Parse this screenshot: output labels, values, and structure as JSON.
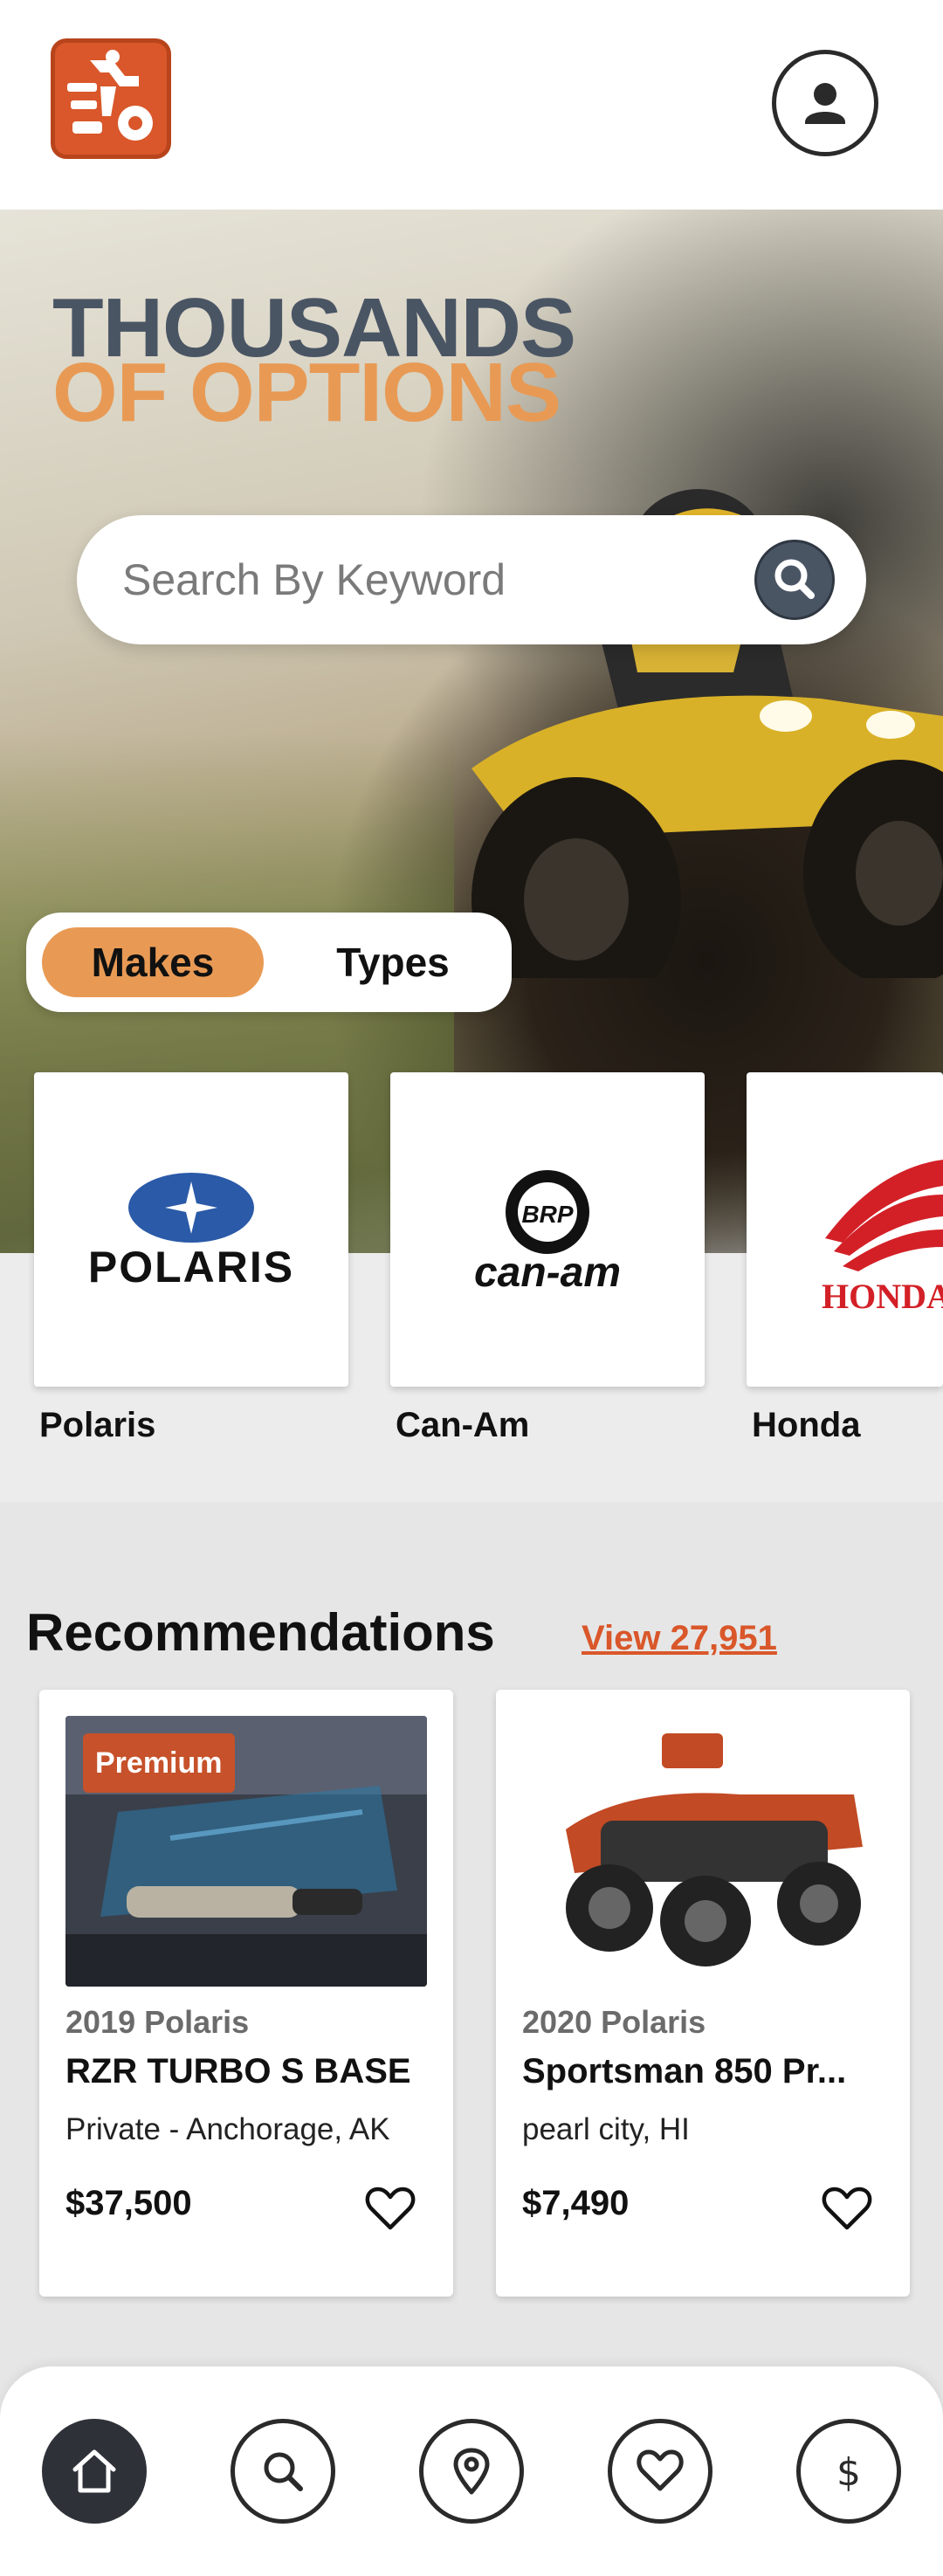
{
  "header": {
    "logo_icon": "atv-rider-logo-icon",
    "account_icon": "user-icon",
    "brand_color": "#d9572a"
  },
  "hero": {
    "title_line1": "THOUSANDS",
    "title_line2": "OF OPTIONS",
    "title_line1_color": "#4a5564",
    "title_line2_color": "#e89a55",
    "search": {
      "placeholder": "Search By Keyword",
      "button_icon": "search-icon"
    },
    "segments": [
      {
        "label": "Makes",
        "selected": true
      },
      {
        "label": "Types",
        "selected": false
      }
    ]
  },
  "brands": [
    {
      "name": "Polaris",
      "logo_text": "POLARIS"
    },
    {
      "name": "Can-Am",
      "logo_text": "can-am",
      "logo_badge": "BRP"
    },
    {
      "name": "Honda",
      "logo_text": "HONDA"
    }
  ],
  "recommendations": {
    "title": "Recommendations",
    "view_all": "View 27,951",
    "listings": [
      {
        "badge": "Premium",
        "year_make": "2019 Polaris",
        "model": "RZR TURBO S BASE",
        "location": "Private - Anchorage, AK",
        "price": "$37,500"
      },
      {
        "badge": "",
        "year_make": "2020 Polaris",
        "model": "Sportsman 850 Pr...",
        "location": "pearl city, HI",
        "price": "$7,490"
      }
    ]
  },
  "bottom_nav": {
    "items": [
      {
        "icon": "home-icon",
        "active": true
      },
      {
        "icon": "search-icon",
        "active": false
      },
      {
        "icon": "location-pin-icon",
        "active": false
      },
      {
        "icon": "heart-icon",
        "active": false
      },
      {
        "icon": "dollar-icon",
        "active": false
      }
    ]
  }
}
